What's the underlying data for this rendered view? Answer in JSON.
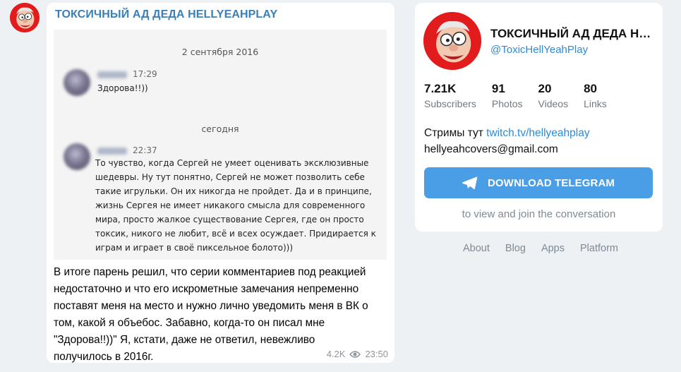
{
  "post": {
    "channel_name": "ТОКСИЧНЫЙ АД ДЕДА HELLYEAHPLAY",
    "screenshot": {
      "date_1": "2 сентября 2016",
      "msg1_time": "17:29",
      "msg1_text": "Здорова!!))",
      "date_2": "сегодня",
      "msg2_time": "22:37",
      "msg2_lines": [
        "То чувство, когда Сергей не умеет оценивать эксклюзивные",
        "шедевры. Ну тут понятно, Сергей не может позволить себе",
        "такие игрульки. Он их никогда не пройдет. Да и в принципе,",
        "жизнь Сергея не имеет никакого смысла для современного",
        "мира, просто жалкое существование Сергея, где он просто",
        "токсик, никого не любит, всё и всех осуждает. Придирается к",
        "играм и играет в своё пиксельное болото)))"
      ]
    },
    "body_lines": [
      "В итоге парень решил, что серии комментариев под реакцией",
      "недостаточно и что его искрометные замечания непременно",
      "поставят меня на место и нужно лично уведомить меня в ВК о",
      "том, какой я объебос. Забавно, когда-то он писал мне",
      "\"Здорова!!))\" Я, кстати, даже не ответил, невежливо",
      "получилось в 2016г."
    ],
    "views": "4.2K",
    "time": "23:50"
  },
  "card": {
    "title": "ТОКСИЧНЫЙ АД ДЕДА HELLYEAHPLAY",
    "handle": "@ToxicHellYeahPlay",
    "stats": [
      {
        "value": "7.21K",
        "label": "Subscribers"
      },
      {
        "value": "91",
        "label": "Photos"
      },
      {
        "value": "20",
        "label": "Videos"
      },
      {
        "value": "80",
        "label": "Links"
      }
    ],
    "desc_prefix": "Стримы тут ",
    "desc_link": "twitch.tv/hellyeahplay",
    "email": "hellyeahcovers@gmail.com",
    "download_label": "DOWNLOAD TELEGRAM",
    "hint": "to view and join the conversation"
  },
  "footer": {
    "links": [
      "About",
      "Blog",
      "Apps",
      "Platform"
    ]
  },
  "colors": {
    "accent": "#4a9ee5",
    "link": "#2d8ad8",
    "avatar_red": "#e21c1c"
  },
  "icons": {
    "views": "eye-icon",
    "download": "paper-plane-icon"
  }
}
